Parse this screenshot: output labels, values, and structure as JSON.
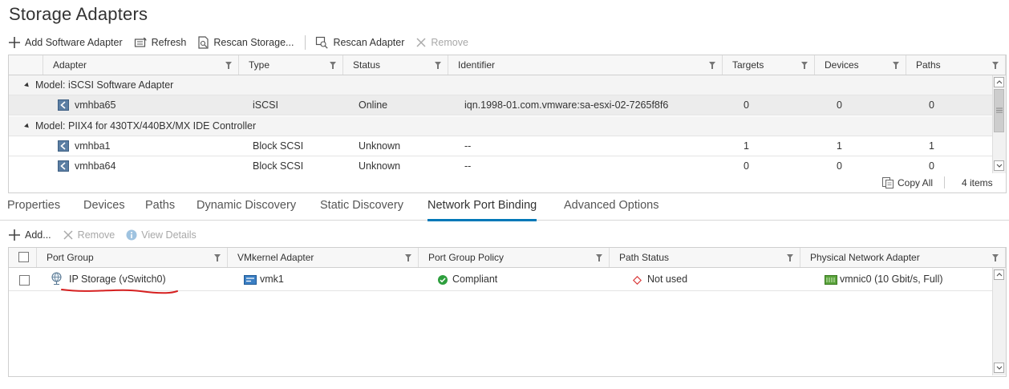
{
  "page": {
    "title": "Storage Adapters"
  },
  "toolbar": {
    "add_software_adapter": "Add Software Adapter",
    "refresh": "Refresh",
    "rescan_storage": "Rescan Storage...",
    "rescan_adapter": "Rescan Adapter",
    "remove": "Remove"
  },
  "adapters_table": {
    "columns": [
      "Adapter",
      "Type",
      "Status",
      "Identifier",
      "Targets",
      "Devices",
      "Paths"
    ],
    "groups": [
      {
        "label": "Model: iSCSI Software Adapter",
        "rows": [
          {
            "adapter": "vmhba65",
            "type": "iSCSI",
            "status": "Online",
            "identifier": "iqn.1998-01.com.vmware:sa-esxi-02-7265f8f6",
            "targets": "0",
            "devices": "0",
            "paths": "0"
          }
        ]
      },
      {
        "label": "Model: PIIX4 for 430TX/440BX/MX IDE Controller",
        "rows": [
          {
            "adapter": "vmhba1",
            "type": "Block SCSI",
            "status": "Unknown",
            "identifier": "--",
            "targets": "1",
            "devices": "1",
            "paths": "1"
          },
          {
            "adapter": "vmhba64",
            "type": "Block SCSI",
            "status": "Unknown",
            "identifier": "--",
            "targets": "0",
            "devices": "0",
            "paths": "0"
          }
        ]
      }
    ],
    "footer": {
      "copy_all": "Copy All",
      "item_count": "4 items"
    }
  },
  "tabs": [
    "Properties",
    "Devices",
    "Paths",
    "Dynamic Discovery",
    "Static Discovery",
    "Network Port Binding",
    "Advanced Options"
  ],
  "active_tab": "Network Port Binding",
  "binding_toolbar": {
    "add": "Add...",
    "remove": "Remove",
    "view_details": "View Details"
  },
  "binding_table": {
    "columns": [
      "Port Group",
      "VMkernel Adapter",
      "Port Group Policy",
      "Path Status",
      "Physical Network Adapter"
    ],
    "rows": [
      {
        "port_group": "IP Storage (vSwitch0)",
        "vmkernel_adapter": "vmk1",
        "port_group_policy": "Compliant",
        "path_status": "Not used",
        "physical_adapter": "vmnic0 (10 Gbit/s, Full)"
      }
    ]
  },
  "colors": {
    "accent": "#0079b8",
    "compliant": "#2e9f3e",
    "not_used": "#d93a3a",
    "annotation": "#d62020"
  }
}
